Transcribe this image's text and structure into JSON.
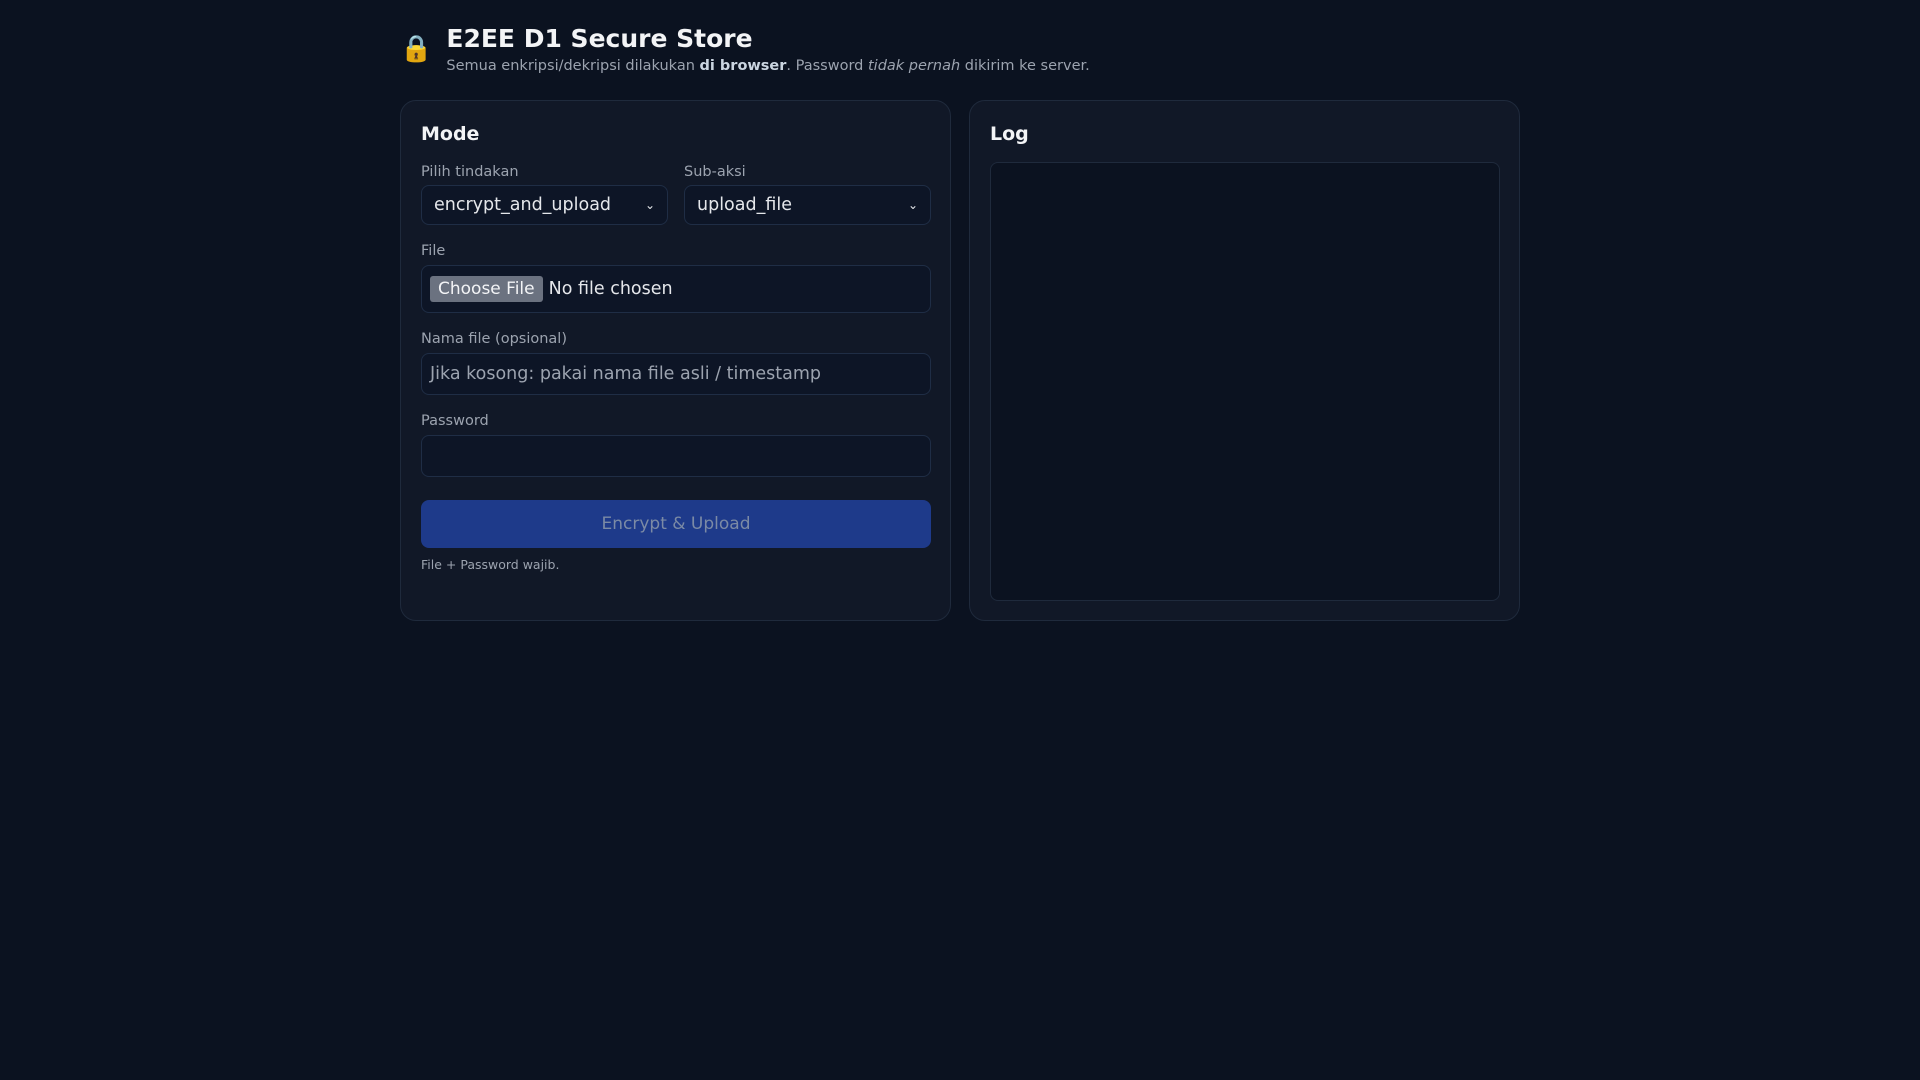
{
  "header": {
    "title": "E2EE D1 Secure Store",
    "sub_1": "Semua enkripsi/dekripsi dilakukan ",
    "sub_bold": "di browser",
    "sub_2": ". Password ",
    "sub_italic": "tidak pernah",
    "sub_3": " dikirim ke server."
  },
  "mode": {
    "heading": "Mode",
    "action_label": "Pilih tindakan",
    "action_value": "encrypt_and_upload",
    "subaction_label": "Sub-aksi",
    "subaction_value": "upload_file",
    "file_label": "File",
    "choose_file": "Choose File",
    "no_file": "No file chosen",
    "filename_label": "Nama file (opsional)",
    "filename_placeholder": "Jika kosong: pakai nama file asli / timestamp",
    "password_label": "Password",
    "password_value": "",
    "submit": "Encrypt & Upload",
    "hint": "File + Password wajib."
  },
  "log": {
    "heading": "Log",
    "content": ""
  }
}
